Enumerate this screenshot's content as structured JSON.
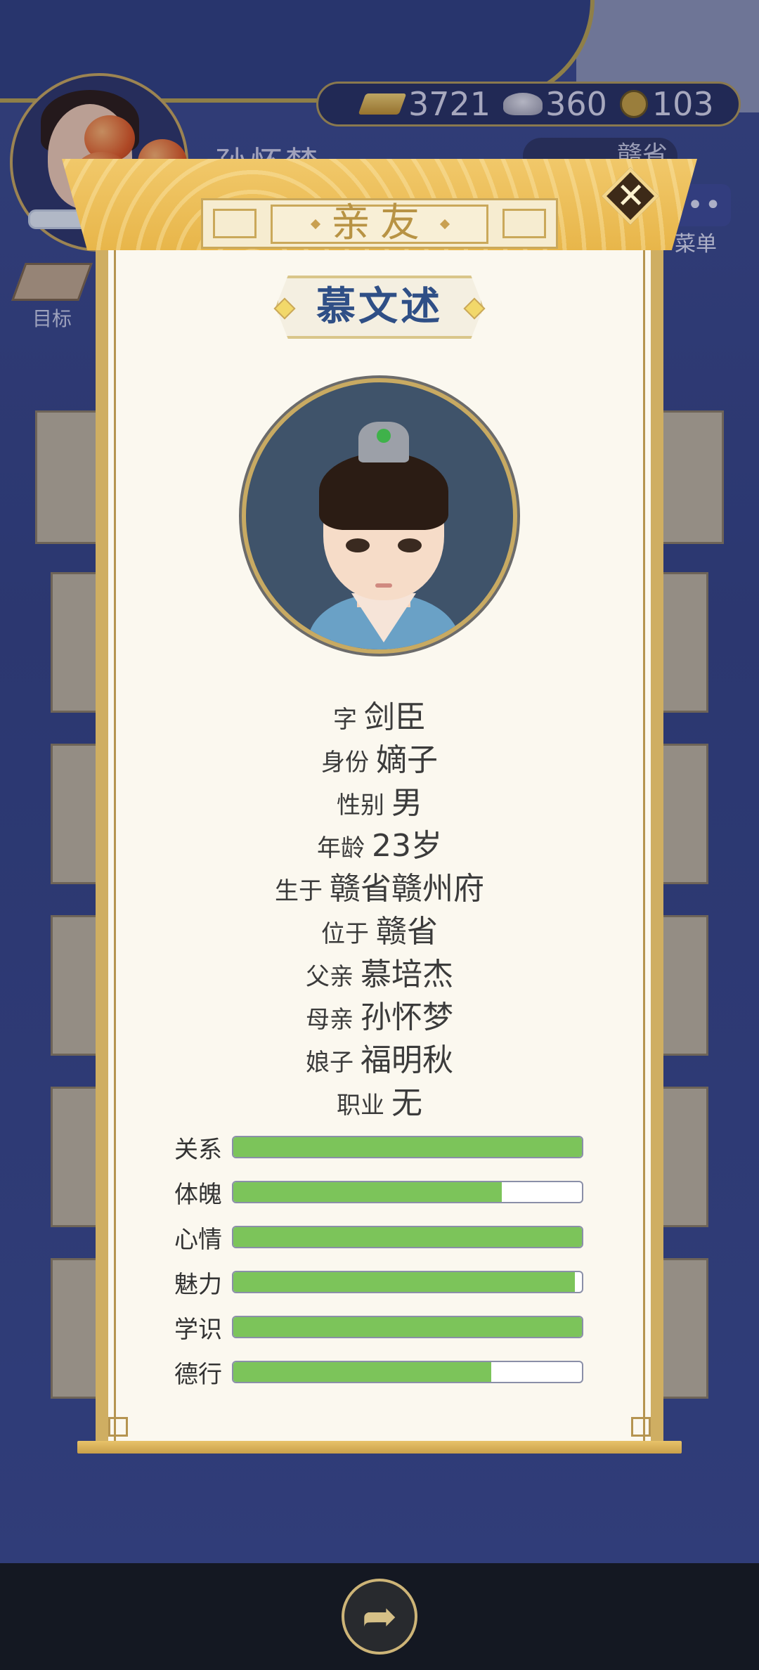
{
  "top_bar": {
    "currencies": [
      {
        "icon": "gold-bar-icon",
        "value": "3721"
      },
      {
        "icon": "silver-ingot-icon",
        "value": "360"
      },
      {
        "icon": "copper-coin-icon",
        "value": "103"
      }
    ],
    "mother_name": "孙怀梦",
    "location": "赣省",
    "menu_label": "菜单",
    "target_label": "目标",
    "menu_dots": "•••"
  },
  "modal": {
    "title": "亲友",
    "close_symbol": "✕",
    "character_name": "慕文述",
    "info": [
      {
        "k": "字",
        "v": "剑臣"
      },
      {
        "k": "身份",
        "v": "嫡子"
      },
      {
        "k": "性别",
        "v": "男"
      },
      {
        "k": "年龄",
        "v": "23岁"
      },
      {
        "k": "生于",
        "v": "赣省赣州府"
      },
      {
        "k": "位于",
        "v": "赣省"
      },
      {
        "k": "父亲",
        "v": "慕培杰"
      },
      {
        "k": "母亲",
        "v": "孙怀梦"
      },
      {
        "k": "娘子",
        "v": "福明秋"
      },
      {
        "k": "职业",
        "v": "无"
      }
    ],
    "stats": [
      {
        "label": "关系",
        "level": 1.0
      },
      {
        "label": "体魄",
        "level": 0.77
      },
      {
        "label": "心情",
        "level": 1.0
      },
      {
        "label": "魅力",
        "level": 0.98
      },
      {
        "label": "学识",
        "level": 1.0
      },
      {
        "label": "德行",
        "level": 0.74
      }
    ],
    "bar_color": "#7cc45a"
  },
  "bottom": {
    "share_icon": "share-arrow-icon",
    "share_glyph": "➦"
  }
}
